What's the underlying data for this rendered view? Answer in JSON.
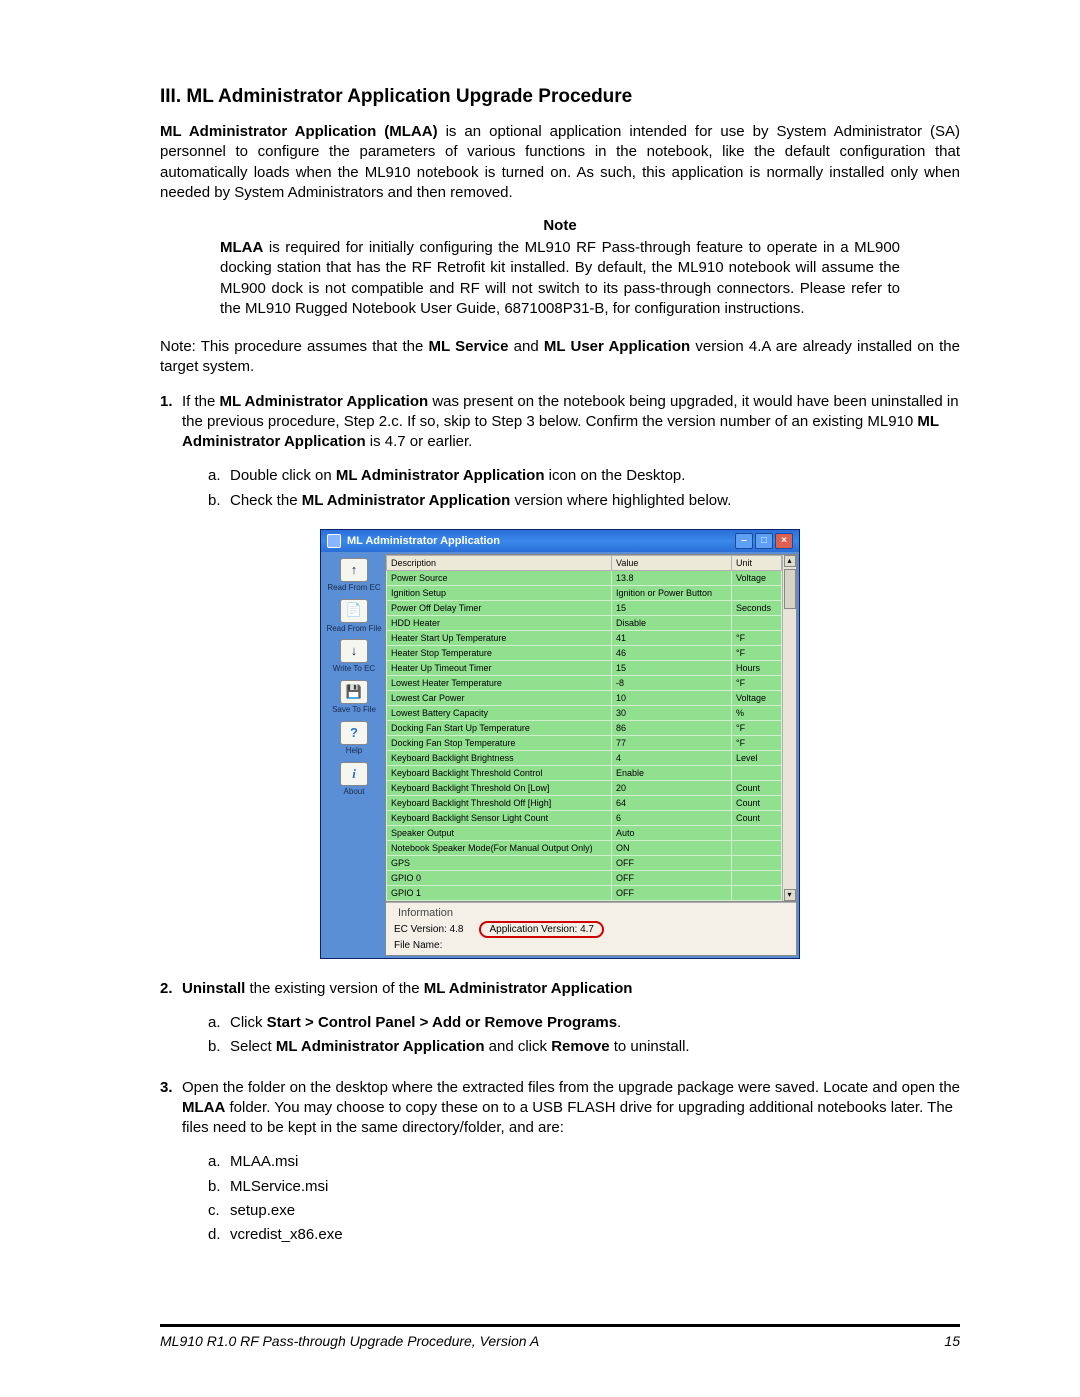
{
  "heading": "III.  ML Administrator Application Upgrade Procedure",
  "intro": {
    "p1_a": "ML Administrator Application (MLAA)",
    "p1_b": " is an optional application intended for use by System Administrator (SA) personnel to configure the parameters of various functions in the notebook, like the default configuration that automatically loads when the ML910 notebook is turned on.  As such, this application is normally installed only when needed by System Administrators and then removed."
  },
  "note": {
    "title": "Note",
    "body_a": "MLAA",
    "body_b": " is required for initially configuring the ML910 RF Pass-through feature to operate in a ML900 docking station that has the RF Retrofit kit installed. By default, the ML910 notebook will assume the ML900 dock is not compatible and RF will not switch to its pass-through connectors. Please refer to the ML910 Rugged Notebook User Guide, 6871008P31-B, for configuration instructions."
  },
  "assume": {
    "pre": "Note: This procedure assumes that the ",
    "b1": "ML Service",
    "mid": " and ",
    "b2": "ML User Application",
    "post": " version 4.A are already installed on the target system."
  },
  "step1": {
    "num": "1.",
    "pre": "If the ",
    "b1": "ML Administrator Application",
    "mid1": " was present on the notebook being upgraded, it would have been uninstalled in the previous procedure, Step 2.c.  If so, skip to Step 3 below.  Confirm the version number of an existing ML910 ",
    "b2": "ML Administrator Application",
    "post": " is 4.7 or earlier.",
    "a": {
      "l": "a.",
      "pre": "Double click on ",
      "b": "ML Administrator Application",
      "post": " icon on the Desktop."
    },
    "b": {
      "l": "b.",
      "pre": "Check the ",
      "b": "ML Administrator Application",
      "post": " version where highlighted below."
    }
  },
  "app_window": {
    "title": "ML Administrator Application",
    "sidebar": [
      {
        "icon": "↑",
        "label": "Read From EC"
      },
      {
        "icon": "📄",
        "label": "Read From File"
      },
      {
        "icon": "↓",
        "label": "Write To EC"
      },
      {
        "icon": "💾",
        "label": "Save To File"
      },
      {
        "icon": "?",
        "label": "Help"
      },
      {
        "icon": "i",
        "label": "About"
      }
    ],
    "columns": {
      "c1": "Description",
      "c2": "Value",
      "c3": "Unit"
    },
    "rows": [
      {
        "d": "Power Source",
        "v": "13.8",
        "u": "Voltage"
      },
      {
        "d": "Ignition Setup",
        "v": "Ignition or Power Button",
        "u": ""
      },
      {
        "d": "Power Off Delay Timer",
        "v": "15",
        "u": "Seconds"
      },
      {
        "d": "HDD Heater",
        "v": "Disable",
        "u": ""
      },
      {
        "d": "Heater Start Up Temperature",
        "v": "41",
        "u": "°F"
      },
      {
        "d": "Heater Stop Temperature",
        "v": "46",
        "u": "°F"
      },
      {
        "d": "Heater Up Timeout Timer",
        "v": "15",
        "u": "Hours"
      },
      {
        "d": "Lowest Heater Temperature",
        "v": "-8",
        "u": "°F"
      },
      {
        "d": "Lowest Car Power",
        "v": "10",
        "u": "Voltage"
      },
      {
        "d": "Lowest Battery Capacity",
        "v": "30",
        "u": "%"
      },
      {
        "d": "Docking Fan Start Up Temperature",
        "v": "86",
        "u": "°F"
      },
      {
        "d": "Docking Fan Stop Temperature",
        "v": "77",
        "u": "°F"
      },
      {
        "d": "Keyboard Backlight Brightness",
        "v": "4",
        "u": "Level"
      },
      {
        "d": "Keyboard Backlight Threshold Control",
        "v": "Enable",
        "u": ""
      },
      {
        "d": "Keyboard Backlight Threshold On [Low]",
        "v": "20",
        "u": "Count"
      },
      {
        "d": "Keyboard Backlight Threshold Off [High]",
        "v": "64",
        "u": "Count"
      },
      {
        "d": "Keyboard Backlight Sensor Light Count",
        "v": "6",
        "u": "Count"
      },
      {
        "d": "Speaker Output",
        "v": "Auto",
        "u": ""
      },
      {
        "d": "Notebook Speaker Mode(For Manual Output Only)",
        "v": "ON",
        "u": ""
      },
      {
        "d": "GPS",
        "v": "OFF",
        "u": ""
      },
      {
        "d": "GPIO 0",
        "v": "OFF",
        "u": ""
      },
      {
        "d": "GPIO 1",
        "v": "OFF",
        "u": ""
      }
    ],
    "info": {
      "legend": "Information",
      "ec": "EC Version:  4.8",
      "appver": "Application Version:  4.7",
      "file": "File Name:"
    }
  },
  "step2": {
    "num": "2.",
    "b1": "Uninstall",
    "mid": " the existing version of the ",
    "b2": "ML Administrator Application",
    "a": {
      "l": "a.",
      "pre": "Click ",
      "b": "Start > Control Panel > Add or Remove Programs",
      "post": "."
    },
    "b": {
      "l": "b.",
      "pre": "Select ",
      "b1": "ML Administrator Application",
      "mid": " and click ",
      "b2": "Remove",
      "post": " to uninstall."
    }
  },
  "step3": {
    "num": "3.",
    "pre": "Open the folder on the desktop where the extracted files from the upgrade package were saved.  Locate and open the ",
    "b": "MLAA",
    "post": " folder.  You may choose to copy these on to a USB FLASH drive for upgrading additional notebooks later.  The files need to be kept in the same directory/folder, and are:",
    "files": {
      "a": {
        "l": "a.",
        "t": "MLAA.msi"
      },
      "b": {
        "l": "b.",
        "t": "MLService.msi"
      },
      "c": {
        "l": "c.",
        "t": "setup.exe"
      },
      "d": {
        "l": "d.",
        "t": "vcredist_x86.exe"
      }
    }
  },
  "footer": {
    "doc": "ML910 R1.0 RF Pass-through Upgrade Procedure, Version A",
    "page": "15"
  }
}
